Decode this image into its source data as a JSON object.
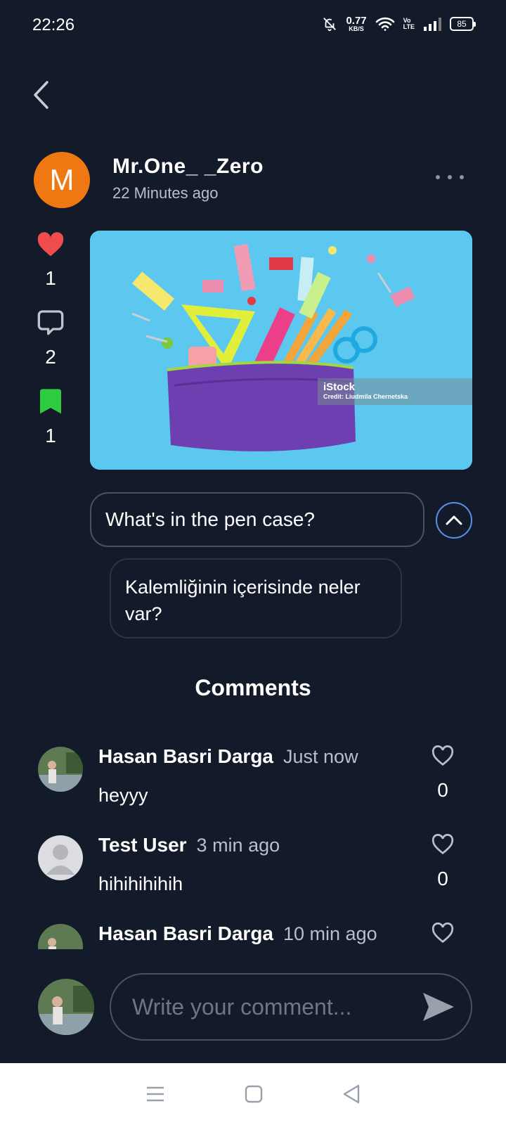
{
  "status_bar": {
    "time": "22:26",
    "speed_value": "0.77",
    "speed_unit": "KB/S",
    "volte_top": "Vo",
    "volte_bottom": "LTE",
    "battery": "85"
  },
  "post": {
    "avatar_letter": "M",
    "username": "Mr.One_ _Zero",
    "time_ago": "22 Minutes ago",
    "likes": "1",
    "comments": "2",
    "saves": "1",
    "image_watermark": "iStock",
    "image_credit": "Credit: Liudmila Chernetska",
    "question": "What's in the pen case?",
    "translation": "Kalemliğinin içerisinde neler var?"
  },
  "comments_title": "Comments",
  "comments": [
    {
      "name": "Hasan Basri Darga",
      "time": "Just now",
      "text": "heyyy",
      "likes": "0"
    },
    {
      "name": "Test User",
      "time": "3 min ago",
      "text": "hihihihihih",
      "likes": "0"
    },
    {
      "name": "Hasan Basri Darga",
      "time": "10 min ago",
      "text": "",
      "likes": ""
    }
  ],
  "composer": {
    "placeholder": "Write your comment..."
  },
  "colors": {
    "background": "#131a2a",
    "avatar_orange": "#f07812",
    "like_red": "#f04c4c",
    "save_green": "#2ecc40",
    "accent_blue": "#5d8fe8"
  }
}
